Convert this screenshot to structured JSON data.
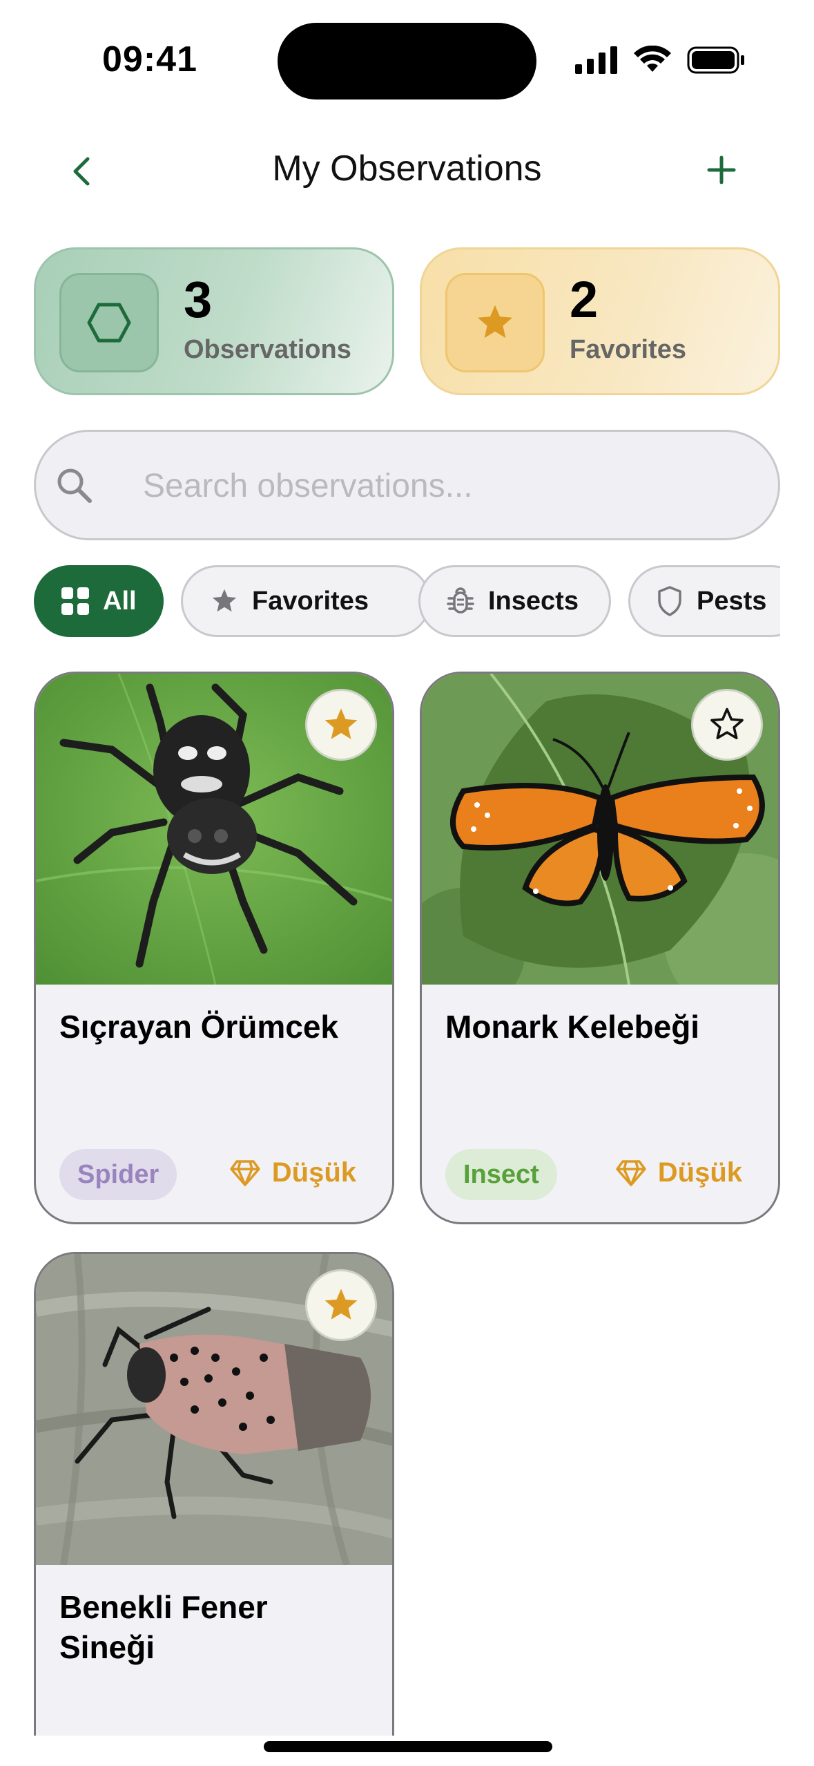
{
  "status_bar": {
    "time": "09:41"
  },
  "nav": {
    "title": "My Observations",
    "back_icon": "chevron-left-icon",
    "add_icon": "plus-icon"
  },
  "stats": [
    {
      "value": "3",
      "label": "Observations",
      "icon": "hexagon-icon",
      "color": "#1d6b3b"
    },
    {
      "value": "2",
      "label": "Favorites",
      "icon": "star-icon",
      "color": "#dd9a22"
    }
  ],
  "search": {
    "placeholder": "Search observations...",
    "value": ""
  },
  "filters": [
    {
      "label": "All",
      "icon": "grid-icon",
      "selected": true
    },
    {
      "label": "Favorites",
      "icon": "star-icon",
      "selected": false
    },
    {
      "label": "Insects",
      "icon": "bug-icon",
      "selected": false
    },
    {
      "label": "Pests",
      "icon": "shield-icon",
      "selected": false
    }
  ],
  "observations": [
    {
      "name": "Sıçrayan Örümcek",
      "category": "Spider",
      "rarity": "Düşük",
      "favorite": true
    },
    {
      "name": "Monark Kelebeği",
      "category": "Insect",
      "rarity": "Düşük",
      "favorite": false
    },
    {
      "name": "Benekli Fener Sineği",
      "category": "",
      "rarity": "",
      "favorite": true
    }
  ],
  "colors": {
    "accent": "#1d6b3b",
    "gold": "#dd9a22",
    "spider_tag": "#9a84bd",
    "insect_tag": "#58a03a"
  }
}
